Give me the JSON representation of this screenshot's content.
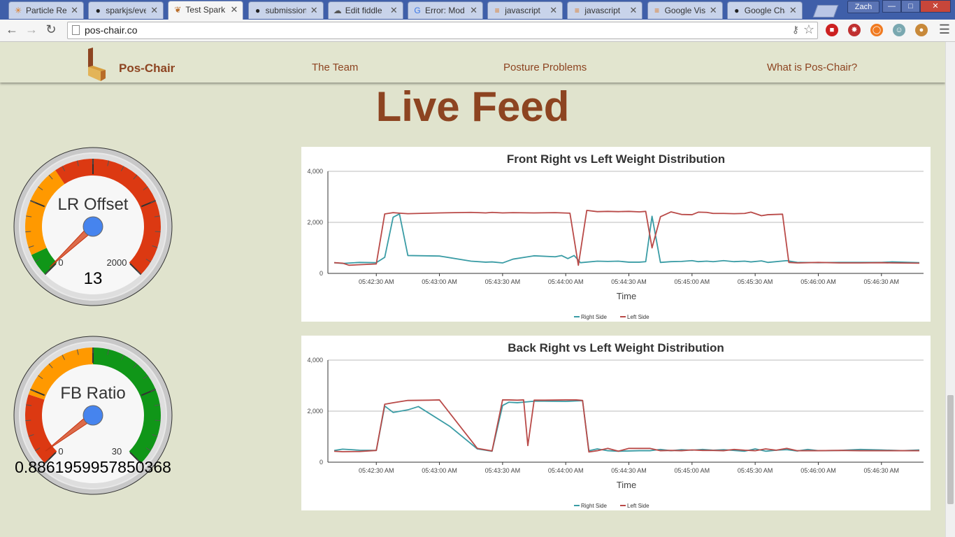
{
  "browser": {
    "tabs": [
      {
        "title": "Particle Ref",
        "icon": "particle-icon",
        "active": false
      },
      {
        "title": "sparkjs/eve",
        "icon": "github-icon",
        "active": false
      },
      {
        "title": "Test Spark",
        "icon": "pos-chair-favicon",
        "active": true
      },
      {
        "title": "submission",
        "icon": "github-icon",
        "active": false
      },
      {
        "title": "Edit fiddle",
        "icon": "jsfiddle-icon",
        "active": false
      },
      {
        "title": "Error: Mod",
        "icon": "google-icon",
        "active": false
      },
      {
        "title": "javascript",
        "icon": "stackoverflow-icon",
        "active": false
      },
      {
        "title": "javascript",
        "icon": "stackoverflow-icon",
        "active": false
      },
      {
        "title": "Google Visu",
        "icon": "stackoverflow-icon",
        "active": false
      },
      {
        "title": "Google Cha",
        "icon": "github-icon",
        "active": false
      }
    ],
    "profile_name": "Zach",
    "url": "pos-chair.co"
  },
  "site": {
    "brand": "Pos-Chair",
    "nav": [
      "The Team",
      "Posture Problems",
      "What is Pos-Chair?"
    ],
    "page_title": "Live Feed"
  },
  "gauges": [
    {
      "label": "LR Offset",
      "value_text": "13",
      "value": 13,
      "min": 0,
      "max": 2000,
      "min_label": "0",
      "max_label": "2000",
      "bands": [
        {
          "from": 0,
          "to": 150,
          "color": "#109618"
        },
        {
          "from": 150,
          "to": 750,
          "color": "#ff9900"
        },
        {
          "from": 750,
          "to": 2000,
          "color": "#dc3912"
        }
      ]
    },
    {
      "label": "FB Ratio",
      "value_text": "0.8861959957850368",
      "value": 0.886,
      "min": 0,
      "max": 30,
      "min_label": "0",
      "max_label": "30",
      "bands": [
        {
          "from": 0,
          "to": 7,
          "color": "#dc3912"
        },
        {
          "from": 7,
          "to": 15,
          "color": "#ff9900"
        },
        {
          "from": 15,
          "to": 30,
          "color": "#109618"
        }
      ]
    }
  ],
  "chart_data": [
    {
      "type": "line",
      "title": "Front Right vs Left Weight Distribution",
      "xlabel": "Time",
      "ylabel": "",
      "ylim": [
        0,
        4000
      ],
      "yticks": [
        "0",
        "2,000",
        "4,000"
      ],
      "xlim": [
        "05:42:07",
        "05:46:50"
      ],
      "xticks": [
        "05:42:30 AM",
        "05:43:00 AM",
        "05:43:30 AM",
        "05:44:00 AM",
        "05:44:30 AM",
        "05:45:00 AM",
        "05:45:30 AM",
        "05:46:00 AM",
        "05:46:30 AM"
      ],
      "grid": true,
      "legend": "bottom",
      "series": [
        {
          "name": "Right Side",
          "color": "#3a9ca5",
          "x": [
            "05:42:10",
            "05:42:14",
            "05:42:22",
            "05:42:30",
            "05:42:34",
            "05:42:38",
            "05:42:41",
            "05:42:45",
            "05:43:00",
            "05:43:15",
            "05:43:22",
            "05:43:25",
            "05:43:30",
            "05:43:35",
            "05:43:45",
            "05:43:55",
            "05:43:58",
            "05:44:01",
            "05:44:04",
            "05:44:07",
            "05:44:15",
            "05:44:20",
            "05:44:25",
            "05:44:30",
            "05:44:35",
            "05:44:38",
            "05:44:41",
            "05:44:45",
            "05:44:50",
            "05:44:55",
            "05:45:00",
            "05:45:03",
            "05:45:07",
            "05:45:10",
            "05:45:15",
            "05:45:20",
            "05:45:25",
            "05:45:28",
            "05:45:33",
            "05:45:36",
            "05:45:45",
            "05:45:50",
            "05:46:00",
            "05:46:10",
            "05:46:20",
            "05:46:30",
            "05:46:35",
            "05:46:48"
          ],
          "y": [
            420,
            390,
            430,
            420,
            630,
            2200,
            2330,
            700,
            680,
            480,
            440,
            450,
            410,
            560,
            690,
            650,
            700,
            580,
            700,
            420,
            480,
            470,
            480,
            440,
            440,
            460,
            2240,
            430,
            460,
            470,
            500,
            460,
            480,
            460,
            500,
            460,
            480,
            450,
            490,
            430,
            500,
            430,
            420,
            430,
            430,
            430,
            450,
            420
          ]
        },
        {
          "name": "Left Side",
          "color": "#b94a48",
          "x": [
            "05:42:10",
            "05:42:14",
            "05:42:17",
            "05:42:30",
            "05:42:34",
            "05:42:38",
            "05:42:41",
            "05:42:45",
            "05:43:00",
            "05:43:15",
            "05:43:22",
            "05:43:25",
            "05:43:30",
            "05:43:35",
            "05:43:45",
            "05:43:55",
            "05:44:02",
            "05:44:06",
            "05:44:10",
            "05:44:15",
            "05:44:20",
            "05:44:25",
            "05:44:30",
            "05:44:35",
            "05:44:38",
            "05:44:41",
            "05:44:45",
            "05:44:50",
            "05:44:55",
            "05:45:00",
            "05:45:03",
            "05:45:07",
            "05:45:10",
            "05:45:15",
            "05:45:20",
            "05:45:25",
            "05:45:28",
            "05:45:33",
            "05:45:36",
            "05:45:43",
            "05:45:46",
            "05:45:50",
            "05:46:00",
            "05:46:10",
            "05:46:20",
            "05:46:30",
            "05:46:35",
            "05:46:48"
          ],
          "y": [
            420,
            400,
            320,
            370,
            2330,
            2380,
            2360,
            2340,
            2370,
            2390,
            2370,
            2390,
            2370,
            2380,
            2370,
            2380,
            2360,
            320,
            2470,
            2420,
            2430,
            2420,
            2430,
            2410,
            2430,
            1000,
            2220,
            2410,
            2310,
            2300,
            2400,
            2390,
            2350,
            2350,
            2340,
            2350,
            2400,
            2260,
            2300,
            2320,
            430,
            410,
            430,
            410,
            410,
            420,
            410,
            400
          ]
        }
      ]
    },
    {
      "type": "line",
      "title": "Back Right vs Left Weight Distribution",
      "xlabel": "Time",
      "ylabel": "",
      "ylim": [
        0,
        4000
      ],
      "yticks": [
        "0",
        "2,000",
        "4,000"
      ],
      "xlim": [
        "05:42:07",
        "05:46:50"
      ],
      "xticks": [
        "05:42:30 AM",
        "05:43:00 AM",
        "05:43:30 AM",
        "05:44:00 AM",
        "05:44:30 AM",
        "05:45:00 AM",
        "05:45:30 AM",
        "05:46:00 AM",
        "05:46:30 AM"
      ],
      "grid": true,
      "legend": "bottom",
      "series": [
        {
          "name": "Right Side",
          "color": "#3a9ca5",
          "x": [
            "05:42:10",
            "05:42:14",
            "05:42:22",
            "05:42:30",
            "05:42:34",
            "05:42:38",
            "05:42:45",
            "05:42:50",
            "05:43:05",
            "05:43:18",
            "05:43:25",
            "05:43:30",
            "05:43:33",
            "05:43:37",
            "05:43:45",
            "05:43:50",
            "05:44:00",
            "05:44:05",
            "05:44:08",
            "05:44:11",
            "05:44:15",
            "05:44:20",
            "05:44:25",
            "05:44:30",
            "05:44:35",
            "05:44:40",
            "05:44:45",
            "05:44:50",
            "05:44:55",
            "05:45:00",
            "05:45:05",
            "05:45:10",
            "05:45:15",
            "05:45:20",
            "05:45:25",
            "05:45:30",
            "05:45:35",
            "05:45:40",
            "05:45:45",
            "05:45:50",
            "05:45:55",
            "05:46:00",
            "05:46:10",
            "05:46:20",
            "05:46:30",
            "05:46:40",
            "05:46:48"
          ],
          "y": [
            460,
            510,
            470,
            460,
            2200,
            1950,
            2050,
            2180,
            1400,
            520,
            430,
            2220,
            2350,
            2330,
            2390,
            2390,
            2380,
            2400,
            2410,
            450,
            520,
            450,
            430,
            440,
            450,
            450,
            500,
            450,
            490,
            470,
            500,
            470,
            490,
            460,
            430,
            520,
            430,
            470,
            490,
            440,
            500,
            450,
            460,
            500,
            480,
            450,
            480
          ]
        },
        {
          "name": "Left Side",
          "color": "#b94a48",
          "x": [
            "05:42:10",
            "05:42:14",
            "05:42:22",
            "05:42:30",
            "05:42:34",
            "05:42:38",
            "05:42:45",
            "05:42:55",
            "05:43:00",
            "05:43:18",
            "05:43:25",
            "05:43:30",
            "05:43:33",
            "05:43:37",
            "05:43:40",
            "05:43:42",
            "05:43:45",
            "05:43:50",
            "05:44:00",
            "05:44:05",
            "05:44:08",
            "05:44:11",
            "05:44:15",
            "05:44:20",
            "05:44:25",
            "05:44:30",
            "05:44:35",
            "05:44:40",
            "05:44:45",
            "05:44:50",
            "05:44:55",
            "05:45:00",
            "05:45:05",
            "05:45:10",
            "05:45:15",
            "05:45:20",
            "05:45:25",
            "05:45:30",
            "05:45:35",
            "05:45:40",
            "05:45:45",
            "05:45:50",
            "05:45:55",
            "05:46:00",
            "05:46:10",
            "05:46:20",
            "05:46:30",
            "05:46:40",
            "05:46:48"
          ],
          "y": [
            430,
            410,
            420,
            460,
            2270,
            2330,
            2420,
            2430,
            2440,
            540,
            440,
            2440,
            2440,
            2430,
            2440,
            650,
            2430,
            2430,
            2440,
            2440,
            2420,
            400,
            450,
            540,
            430,
            540,
            540,
            540,
            450,
            460,
            450,
            480,
            460,
            460,
            450,
            500,
            470,
            450,
            520,
            470,
            540,
            450,
            450,
            450,
            460,
            450,
            450,
            450,
            450
          ]
        }
      ]
    }
  ]
}
